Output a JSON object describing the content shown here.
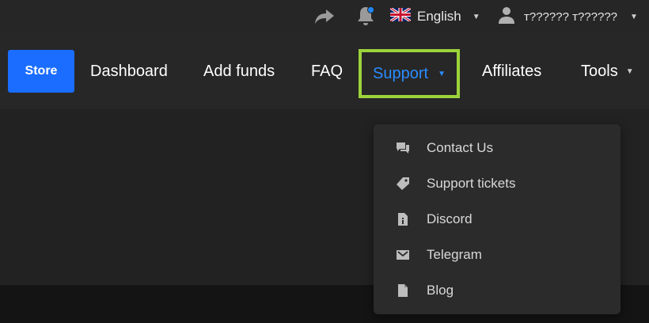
{
  "topbar": {
    "language": {
      "label": "English",
      "flag_icon": "uk-flag-icon"
    },
    "user": {
      "name": "т?????? т??????"
    },
    "notification_badge_color": "#1e88ff"
  },
  "nav": {
    "store_label": "Store",
    "items": [
      {
        "label": "Dashboard"
      },
      {
        "label": "Add funds"
      },
      {
        "label": "FAQ"
      },
      {
        "label": "Support",
        "active": true
      },
      {
        "label": "Affiliates"
      },
      {
        "label": "Tools"
      }
    ]
  },
  "support_menu": {
    "items": [
      {
        "label": "Contact Us",
        "icon": "chat-icon"
      },
      {
        "label": "Support tickets",
        "icon": "tag-icon"
      },
      {
        "label": "Discord",
        "icon": "file-info-icon"
      },
      {
        "label": "Telegram",
        "icon": "envelope-icon"
      },
      {
        "label": "Blog",
        "icon": "document-icon"
      }
    ]
  },
  "colors": {
    "accent": "#1a6dff",
    "active_link": "#2a8cff",
    "highlight_border": "#9cd33b",
    "background": "#1e1e1e"
  }
}
